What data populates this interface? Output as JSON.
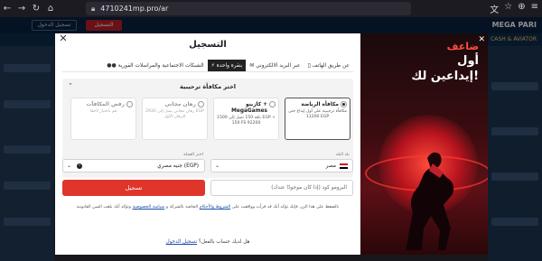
{
  "browser": {
    "url": "4710241mp.pro/ar",
    "icons": [
      "back-icon",
      "forward-icon",
      "reload-icon",
      "home-icon",
      "lock-icon",
      "translate-icon",
      "bookmark-star-icon",
      "extensions-icon",
      "menu-icon"
    ]
  },
  "site": {
    "brand": "MEGA PARI",
    "register": "التسجيل",
    "login": "تسجيل الدخول",
    "category": "CASH & AVIATOR"
  },
  "modal": {
    "title": "التسجيل",
    "tabs": [
      {
        "label": "عن طريق الهاتف",
        "icon": "phone-icon",
        "active": false
      },
      {
        "label": "عبر البريد الالكتروني",
        "icon": "email-icon",
        "active": false
      },
      {
        "label": "بنقرة واحدة",
        "icon": "one-click-icon",
        "active": true
      },
      {
        "label": "الشبكات الاجتماعية والمراسلات الفورية",
        "icon": "social-icon",
        "active": false
      }
    ],
    "bonus": {
      "heading": "اختر مكافأة ترحيبية",
      "cards": [
        {
          "title": "مكافأة الرياضة",
          "desc": "مكافأة ترحيبية على أول إيداع حتى 11200 EGP",
          "selected": true
        },
        {
          "title": "كازينو + MegaGames",
          "desc": "باقة 150 تصل إلى 1500 EGP + 150 FS 92200",
          "selected": false
        },
        {
          "title": "رهان مجاني",
          "desc": "رهان مجاني يصل إلى 2930 EGP للرهان الأول",
          "selected": false
        },
        {
          "title": "رفض المكافآت",
          "desc": "قم باختيار لاحقا",
          "selected": false
        }
      ]
    },
    "country": {
      "label": "بلد البلد",
      "value": "مصر"
    },
    "currency": {
      "label": "اختر العملة",
      "value": "جنيه مصري (EGP)"
    },
    "promo_placeholder": "البرومو كود (إذا كان موجودًا عندك)",
    "register_button": "تسجيل",
    "terms_text": "بالضغط على هذا الزر، فإنك تؤكد أنك قد قرأت ووافقت على",
    "terms_link1": "الشروط والأحكام",
    "terms_mid": "الخاصة بالشركة و",
    "terms_link2": "سياسة الخصوصية",
    "terms_end": "وتؤكد أنك بلغت السن القانونية",
    "login_prompt": "هل لديك حساب بالفعل؟",
    "login_link": "تسجيل الدخول"
  },
  "banner": {
    "line1": "ضاعف",
    "line2": "أول",
    "line3": "إيداعين لك!"
  },
  "colors": {
    "accent": "#e0352b",
    "dark_tab": "#222222",
    "site_header": "#0a2240",
    "banner_red": "#ff4d3d"
  }
}
